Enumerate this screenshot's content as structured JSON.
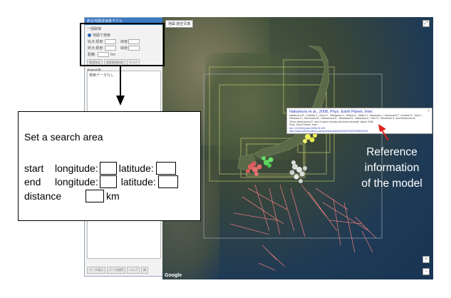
{
  "panel": {
    "title": "統合地震波速度モデル",
    "section_search": "一括取得",
    "radio_label": "地図で検索",
    "row1_label": "始点 経度:",
    "row1_right": "緯度:",
    "row2_label": "終点 経度:",
    "row2_right": "緯度:",
    "row3_label": "距離:",
    "row3_unit": "km",
    "btn_search": "範囲指定",
    "btn_search2": "検索範囲削除",
    "btn_clear": "クリア",
    "section_results": "検索結果",
    "results_text": "検索データなし",
    "bottom_btn1": "データ表示",
    "bottom_btn2": "データ取得",
    "bottom_btn3": "ヘルプ",
    "bottom_btn4": "閉"
  },
  "map": {
    "badge": "地図",
    "badge2": "航空写真",
    "google": "Google",
    "ctrl_full": "⤢",
    "ctrl_plus": "+",
    "ctrl_minus": "−"
  },
  "popup": {
    "title": "Nakamura et al., 2008, Phys. Earth Planet. Inter.",
    "lines": [
      "Nakamura M., Yoshida Y., Zhao D., Takayama H., Obana K., Katao H., Kasahara J., Kanazawa T., Kodaira S., Sato T.,",
      "Shiobara H., Shinohara M., Shimamura H., Takahashi N., Takazawa A., Hino R., Mochizuki K. and Mochizuki M.",
      "Three-dimensional P- and S-wave velocity structures beneath Japan 2008",
      "Phys. Earth Planet. Inter."
    ],
    "doi": "doi: 10.1016/j.pepi.2008.04.013",
    "url": "http://www.sciencedirect.com/science/article/pii/S0031920108001015",
    "close": "×"
  },
  "annotation": {
    "line1": "Reference",
    "line2": "information",
    "line3": "of the model"
  },
  "callout": {
    "title": "Set a search area",
    "start": "start",
    "end": "end",
    "longitude": "longitude:",
    "latitude": "latitude:",
    "distance": "distance",
    "km": "km"
  },
  "colors": {
    "highlight": "#000000",
    "arrow_red": "#e0201a",
    "panel_title_bg": "#3a78c4",
    "popup_link": "#2a3fb8"
  }
}
